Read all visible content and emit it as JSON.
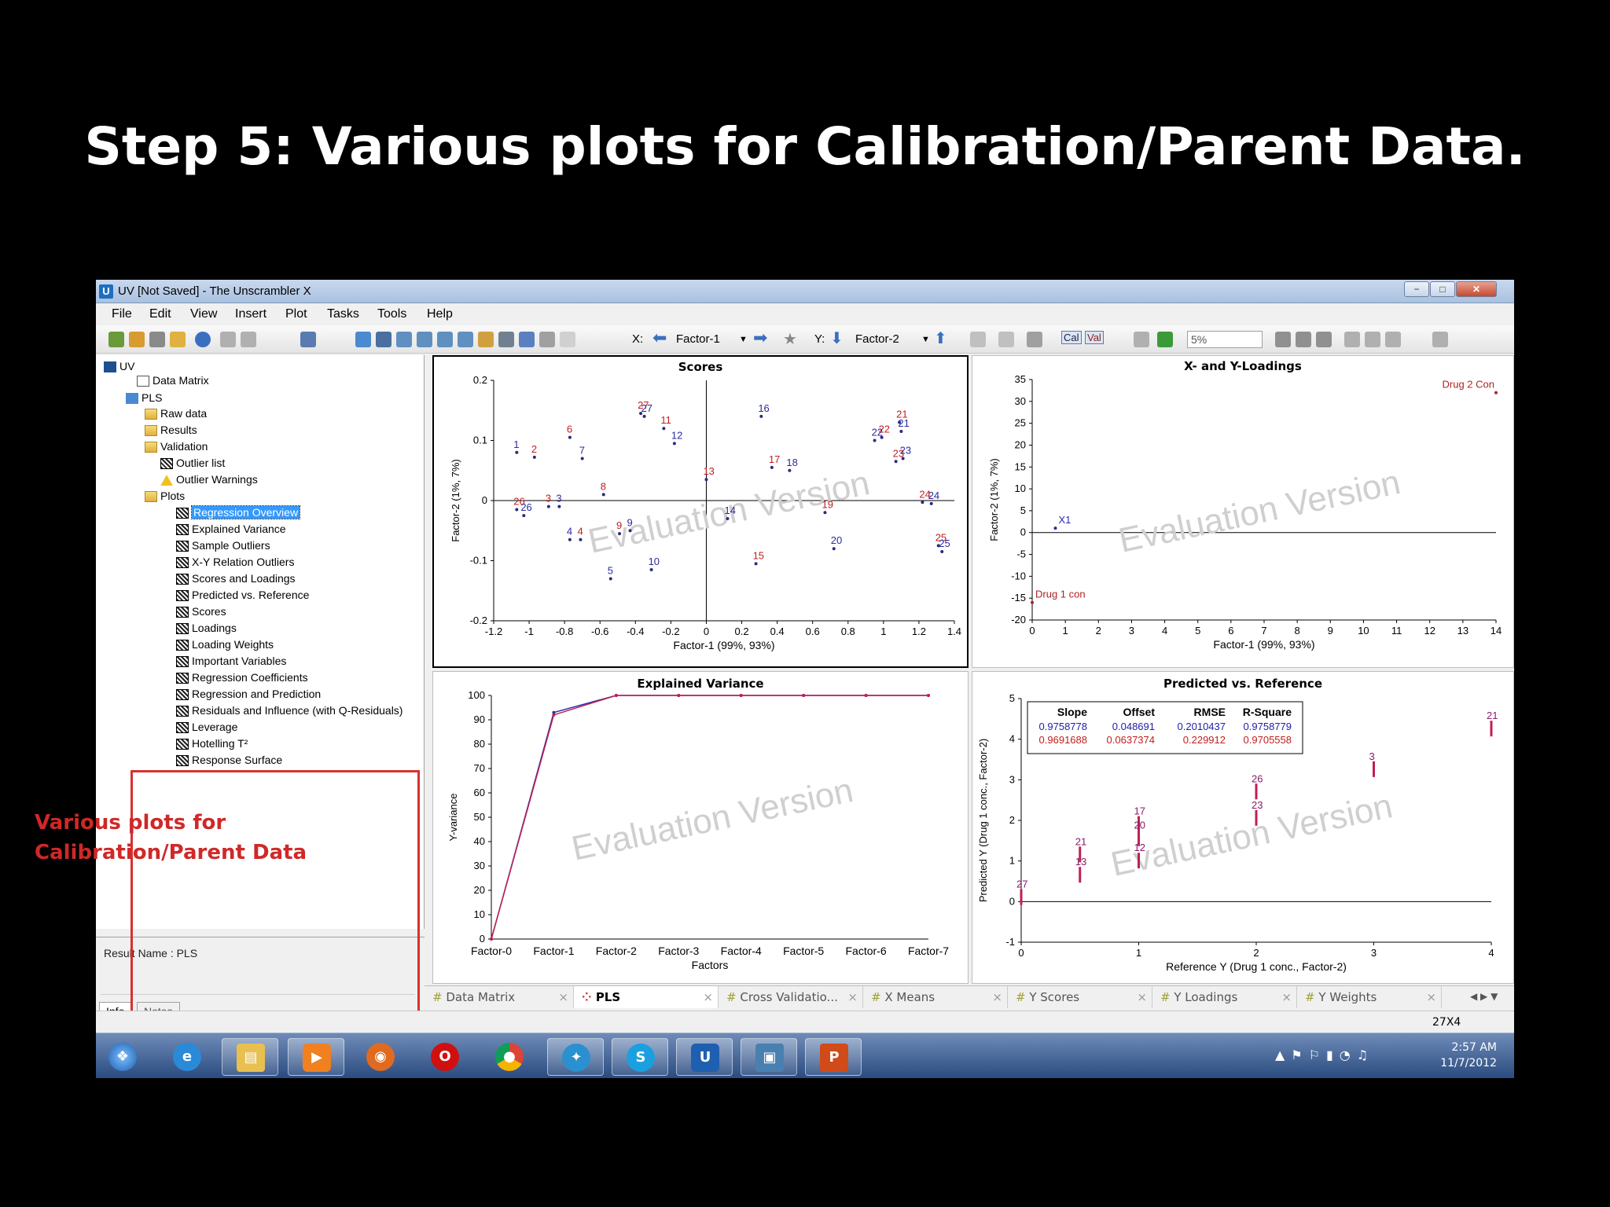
{
  "slide": {
    "title": "Step 5: Various plots for Calibration/Parent Data."
  },
  "window": {
    "title": "UV [Not Saved] - The Unscrambler X",
    "minimize": "−",
    "maximize": "□",
    "close": "✕"
  },
  "menu": [
    "File",
    "Edit",
    "View",
    "Insert",
    "Plot",
    "Tasks",
    "Tools",
    "Help"
  ],
  "toolbar": {
    "x_label": "X:",
    "x_value": "Factor-1",
    "y_label": "Y:",
    "y_value": "Factor-2",
    "cal": "Cal",
    "val": "Val",
    "zoom": "5%"
  },
  "tree": {
    "root": "UV",
    "items": [
      "Data Matrix",
      "PLS",
      "Raw data",
      "Results",
      "Validation",
      "Outlier list",
      "Outlier Warnings",
      "Plots"
    ],
    "plots": [
      "Regression Overview",
      "Explained Variance",
      "Sample Outliers",
      "X-Y Relation Outliers",
      "Scores and Loadings",
      "Predicted vs. Reference",
      "Scores",
      "Loadings",
      "Loading Weights",
      "Important Variables",
      "Regression Coefficients",
      "Regression and Prediction",
      "Residuals and Influence (with Q-Residuals)",
      "Leverage",
      "Hotelling T²",
      "Response Surface"
    ]
  },
  "annotation": {
    "line1": "Various plots for",
    "line2": "Calibration/Parent Data"
  },
  "result": {
    "name": "Result Name : PLS"
  },
  "left_tabs": [
    "Info",
    "Notes"
  ],
  "bottom_tabs": [
    "Data Matrix",
    "PLS",
    "Cross Validatio...",
    "X Means",
    "Y Scores",
    "Y Loadings",
    "Y Weights"
  ],
  "status": {
    "dims": "27X4"
  },
  "taskbar": {
    "time": "2:57 AM",
    "date": "11/7/2012"
  },
  "watermark": "Evaluation Version",
  "icons": [
    "start-orb-icon",
    "internet-explorer-icon",
    "explorer-icon",
    "media-player-icon",
    "firefox-icon",
    "opera-icon",
    "chrome-icon",
    "twitter-icon",
    "skype-icon",
    "unscrambler-icon",
    "photo-icon",
    "powerpoint-icon"
  ],
  "chart_data": [
    {
      "type": "scatter",
      "title": "Scores",
      "xlabel": "Factor-1 (99%, 93%)",
      "ylabel": "Factor-2 (1%, 7%)",
      "xlim": [
        -1.2,
        1.4
      ],
      "ylim": [
        -0.2,
        0.2
      ],
      "xticks": [
        "-1.2",
        "-1",
        "-0.8",
        "-0.6",
        "-0.4",
        "-0.2",
        "0",
        "0.2",
        "0.4",
        "0.6",
        "0.8",
        "1",
        "1.2",
        "1.4"
      ],
      "yticks": [
        "-0.2",
        "-0.1",
        "0",
        "0.1",
        "0.2"
      ],
      "points": [
        {
          "label": "1",
          "x": -1.07,
          "y": 0.08
        },
        {
          "label": "2",
          "x": -0.97,
          "y": 0.072
        },
        {
          "label": "3",
          "x": -0.83,
          "y": -0.01
        },
        {
          "label": "3",
          "x": -0.89,
          "y": -0.01
        },
        {
          "label": "4",
          "x": -0.77,
          "y": -0.065
        },
        {
          "label": "4",
          "x": -0.71,
          "y": -0.065
        },
        {
          "label": "5",
          "x": -0.54,
          "y": -0.13
        },
        {
          "label": "6",
          "x": -0.77,
          "y": 0.105
        },
        {
          "label": "7",
          "x": -0.7,
          "y": 0.07
        },
        {
          "label": "8",
          "x": -0.58,
          "y": 0.01
        },
        {
          "label": "9",
          "x": -0.43,
          "y": -0.05
        },
        {
          "label": "9",
          "x": -0.49,
          "y": -0.055
        },
        {
          "label": "10",
          "x": -0.31,
          "y": -0.115
        },
        {
          "label": "11",
          "x": -0.24,
          "y": 0.12
        },
        {
          "label": "12",
          "x": -0.18,
          "y": 0.095
        },
        {
          "label": "13",
          "x": 0,
          "y": 0.035
        },
        {
          "label": "14",
          "x": 0.12,
          "y": -0.03
        },
        {
          "label": "15",
          "x": 0.28,
          "y": -0.105
        },
        {
          "label": "16",
          "x": 0.31,
          "y": 0.14
        },
        {
          "label": "17",
          "x": 0.37,
          "y": 0.055
        },
        {
          "label": "18",
          "x": 0.47,
          "y": 0.05
        },
        {
          "label": "19",
          "x": 0.67,
          "y": -0.02
        },
        {
          "label": "20",
          "x": 0.72,
          "y": -0.08
        },
        {
          "label": "21",
          "x": 1.09,
          "y": 0.13
        },
        {
          "label": "21",
          "x": 1.1,
          "y": 0.115
        },
        {
          "label": "22",
          "x": 0.99,
          "y": 0.105
        },
        {
          "label": "22",
          "x": 0.95,
          "y": 0.1
        },
        {
          "label": "23",
          "x": 1.07,
          "y": 0.065
        },
        {
          "label": "23",
          "x": 1.11,
          "y": 0.07
        },
        {
          "label": "24",
          "x": 1.22,
          "y": -0.003
        },
        {
          "label": "24",
          "x": 1.27,
          "y": -0.005
        },
        {
          "label": "25",
          "x": 1.31,
          "y": -0.075
        },
        {
          "label": "25",
          "x": 1.33,
          "y": -0.085
        },
        {
          "label": "26",
          "x": -1.07,
          "y": -0.015
        },
        {
          "label": "26",
          "x": -1.03,
          "y": -0.025
        },
        {
          "label": "27",
          "x": -0.37,
          "y": 0.145
        },
        {
          "label": "27",
          "x": -0.35,
          "y": 0.14
        }
      ]
    },
    {
      "type": "scatter",
      "title": "X- and Y-Loadings",
      "xlabel": "Factor-1 (99%, 93%)",
      "ylabel": "Factor-2 (1%, 7%)",
      "xlim": [
        0,
        14
      ],
      "ylim": [
        -20,
        35
      ],
      "xticks": [
        "0",
        "1",
        "2",
        "3",
        "4",
        "5",
        "6",
        "7",
        "8",
        "9",
        "10",
        "11",
        "12",
        "13",
        "14"
      ],
      "yticks": [
        "-20",
        "-15",
        "-10",
        "-5",
        "0",
        "5",
        "10",
        "15",
        "20",
        "25",
        "30",
        "35"
      ],
      "points": [
        {
          "label": "Drug 2 Con",
          "x": 14,
          "y": 32
        },
        {
          "label": "Drug 1 con",
          "x": 0,
          "y": -16
        },
        {
          "label": "X1",
          "x": 0.7,
          "y": 1
        }
      ]
    },
    {
      "type": "line",
      "title": "Explained Variance",
      "xlabel": "Factors",
      "ylabel": "Y-variance",
      "ylim": [
        0,
        100
      ],
      "categories": [
        "Factor-0",
        "Factor-1",
        "Factor-2",
        "Factor-3",
        "Factor-4",
        "Factor-5",
        "Factor-6",
        "Factor-7"
      ],
      "yticks": [
        "0",
        "10",
        "20",
        "30",
        "40",
        "50",
        "60",
        "70",
        "80",
        "90",
        "100"
      ],
      "series": [
        {
          "values": [
            0,
            93,
            100,
            100,
            100,
            100,
            100,
            100
          ]
        },
        {
          "values": [
            0,
            92,
            100,
            100,
            100,
            100,
            100,
            100
          ]
        }
      ]
    },
    {
      "type": "scatter",
      "title": "Predicted vs. Reference",
      "xlabel": "Reference Y (Drug 1 conc., Factor-2)",
      "ylabel": "Predicted Y (Drug 1 conc., Factor-2)",
      "xlim": [
        0,
        4
      ],
      "ylim": [
        -1,
        5
      ],
      "xticks": [
        "0",
        "1",
        "2",
        "3",
        "4"
      ],
      "yticks": [
        "-1",
        "0",
        "1",
        "2",
        "3",
        "4",
        "5"
      ],
      "stats_header": [
        "Slope",
        "Offset",
        "RMSE",
        "R-Square"
      ],
      "stats_rows": [
        [
          "0.9758778",
          "0.048691",
          "0.2010437",
          "0.9758779"
        ],
        [
          "0.9691688",
          "0.0637374",
          "0.229912",
          "0.9705558"
        ]
      ],
      "points": [
        {
          "label": "27",
          "x": 0,
          "y": 0.15
        },
        {
          "label": "21",
          "x": 0.5,
          "y": 1.2
        },
        {
          "label": "13",
          "x": 0.5,
          "y": 0.7
        },
        {
          "label": "17",
          "x": 1,
          "y": 1.95
        },
        {
          "label": "20",
          "x": 1,
          "y": 1.6
        },
        {
          "label": "12",
          "x": 1,
          "y": 1.05
        },
        {
          "label": "26",
          "x": 2,
          "y": 2.75
        },
        {
          "label": "23",
          "x": 2,
          "y": 2.1
        },
        {
          "label": "3",
          "x": 3,
          "y": 3.3
        },
        {
          "label": "21",
          "x": 4,
          "y": 4.3
        }
      ]
    }
  ]
}
